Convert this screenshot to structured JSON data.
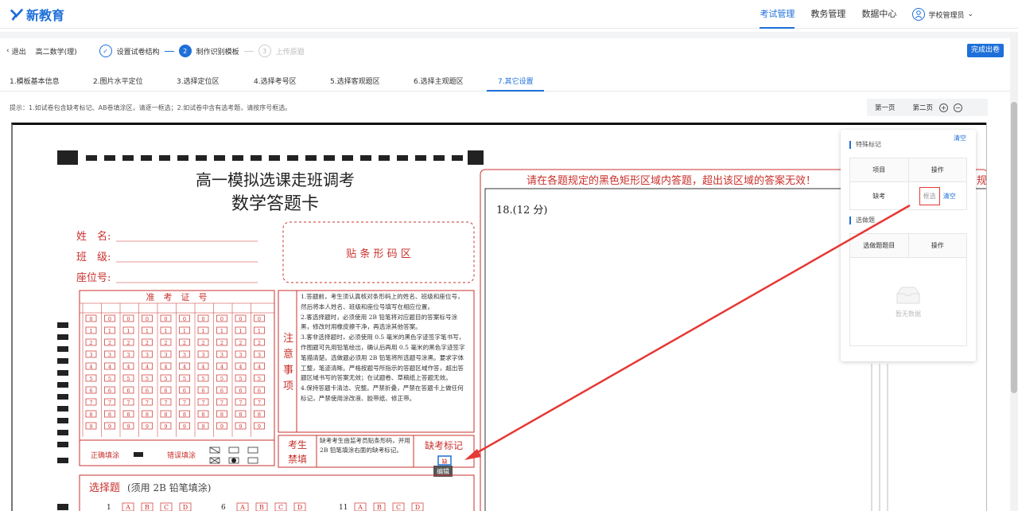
{
  "app": {
    "logo_text": "新教育"
  },
  "nav": {
    "items": [
      {
        "label": "考试管理"
      },
      {
        "label": "教务管理"
      },
      {
        "label": "数据中心"
      }
    ],
    "user": "学校管理员"
  },
  "toolbar": {
    "exit": "退出",
    "subject": "高二数学(理)",
    "steps": [
      {
        "num": "✓",
        "label": "设置试卷结构"
      },
      {
        "num": "2",
        "label": "制作识别模板"
      },
      {
        "num": "3",
        "label": "上传原题"
      }
    ],
    "finish": "完成出卷"
  },
  "tabs": [
    {
      "label": "1.模板基本信息"
    },
    {
      "label": "2.图片水平定位"
    },
    {
      "label": "3.选择定位区"
    },
    {
      "label": "4.选择考号区"
    },
    {
      "label": "5.选择客观题区"
    },
    {
      "label": "6.选择主观题区"
    },
    {
      "label": "7.其它设置"
    }
  ],
  "tip": "提示：1.如试卷包含缺考标记、AB卷填涂区，请逐一框选；2.如试卷中含有选考题，请按序号框选。",
  "pager": {
    "first": "第一页",
    "second": "第二页"
  },
  "card": {
    "title1": "高一模拟选课走班调考",
    "title2": "数学答题卡",
    "name_label": "姓　名:",
    "class_label": "班　级:",
    "seat_label": "座位号:",
    "barcode": "贴 条 形 码 区",
    "exam_no_header": "准　考　证　号",
    "notice_side": [
      "注",
      "意",
      "事",
      "项"
    ],
    "notice": [
      "1.答题前，考生须认真核对条形码上的姓名、班级和座位号，然后将本人姓名、班级和座位号填写在相应位置。",
      "2.客选择题时，必须使用 2B 铅笔将对应题目的答案标号涂黑，修改时用橡皮擦干净，再选涂其他答案。",
      "3.客非选择题时，必须使用 0.5 毫米的黑色字迹签字笔书写，作图题可先用铅笔绘出，确认后再用 0.5 毫米的黑色字迹签字笔描清楚。选做题必须用 2B 铅笔将所选题号涂黑。要求字体工整，笔迹清晰。严格按题号所指示的答题区域作答，超出答题区域书写的答案无效；在试题卷、草稿纸上答题无效。",
      "4.保持答题卡清洁、完整。严禁折叠，严禁在答题卡上做任何标记，严禁使用涂改液、胶带纸、修正带。"
    ],
    "correct": "正确填涂",
    "wrong": "错误填涂",
    "forbid1": "考生",
    "forbid2": "禁填",
    "forbid_text": "缺考考生由监考员贴条形码，并用 2B 铅笔填涂右面的缺考标记。",
    "absent_mark": "缺考标记",
    "absent_box": "缺",
    "edit_tag": "编辑",
    "choice_title": "选择题",
    "choice_note": "(须用 2B 铅笔填涂)",
    "choice_nums": [
      "1",
      "6",
      "11"
    ],
    "choice_opts": [
      "A",
      "B",
      "C",
      "D"
    ],
    "banner": "请在各题规定的黑色矩形区域内答题，超出该区域的答案无效！",
    "banner_tail": "规",
    "q18": "18.(12 分)",
    "digits": [
      "0",
      "1",
      "2",
      "3",
      "4",
      "5",
      "6",
      "7",
      "8",
      "9"
    ]
  },
  "panel": {
    "section1": "特殊标记",
    "clear": "清空",
    "headers": [
      "项目",
      "操作"
    ],
    "row": {
      "item": "缺考",
      "select": "框选",
      "clear": "清空"
    },
    "section2": "选做题",
    "headers2": [
      "选做题题目",
      "操作"
    ],
    "empty": "暂无数据"
  }
}
